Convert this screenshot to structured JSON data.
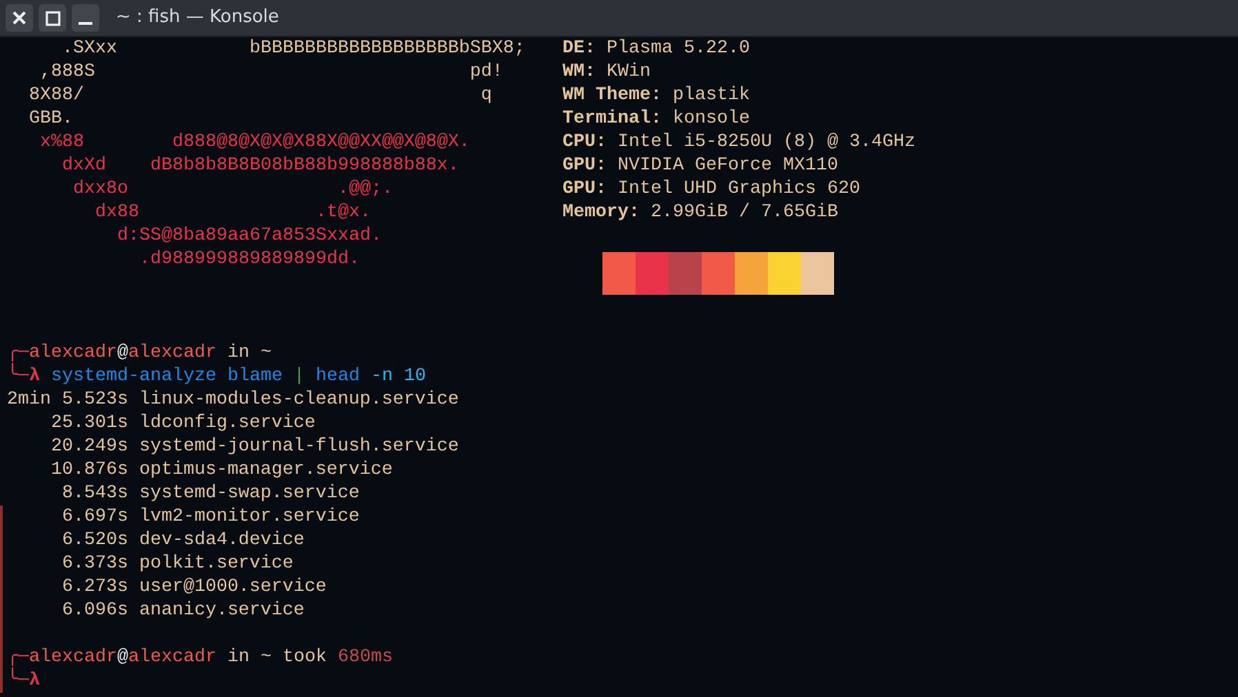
{
  "window": {
    "title": "~ : fish — Konsole"
  },
  "art": [
    {
      "text": "     .SXxx            bBBBBBBBBBBBBBBBBBBbSBX8;",
      "color": "#e6c49a"
    },
    {
      "text": "   ,888S                                  pd!",
      "color": "#e6c49a"
    },
    {
      "text": "  8X88/                                    q",
      "color": "#e6c49a"
    },
    {
      "text": "  GBB.",
      "color": "#e6c49a"
    },
    {
      "text": "   x%88        d888@8@X@X@X88X@@XX@@X@8@X.",
      "color": "#e8334a"
    },
    {
      "text": "     dxXd    dB8b8b8B8B08bB88b998888b88x.",
      "color": "#e8334a"
    },
    {
      "text": "      dxx8o                   .@@;.",
      "color": "#e8334a"
    },
    {
      "text": "        dx88                .t@x.",
      "color": "#e8334a"
    },
    {
      "text": "          d:SS@8ba89aa67a853Sxxad.",
      "color": "#e8334a"
    },
    {
      "text": "            .d988999889889899dd.",
      "color": "#e8334a"
    }
  ],
  "info": [
    {
      "key": "DE",
      "sep": ":",
      "value": "Plasma 5.22.0"
    },
    {
      "key": "WM",
      "sep": ":",
      "value": "KWin"
    },
    {
      "key": "WM Theme",
      "sep": ":",
      "value": "plastik"
    },
    {
      "key": "Terminal",
      "sep": ":",
      "value": "konsole"
    },
    {
      "key": "CPU",
      "sep": ":",
      "value": "Intel i5-8250U (8) @ 3.4GHz"
    },
    {
      "key": "GPU",
      "sep": ":",
      "value": "NVIDIA GeForce MX110"
    },
    {
      "key": "GPU",
      "sep": ":",
      "value": "Intel UHD Graphics 620"
    },
    {
      "key": "Memory",
      "sep": ":",
      "value": "2.99GiB / 7.65GiB"
    }
  ],
  "swatches": [
    {
      "color": "#f25a48"
    },
    {
      "color": "#e8334a"
    },
    {
      "color": "#b8434b"
    },
    {
      "color": "#f25a48"
    },
    {
      "color": "#f5a33b"
    },
    {
      "color": "#fad232"
    },
    {
      "color": "#ecc49d"
    }
  ],
  "session": [
    {
      "kind": "prompt",
      "marked": false,
      "segments": [
        {
          "kind": "decor",
          "text": "╭─"
        },
        {
          "kind": "user",
          "text": "alexcadr"
        },
        {
          "kind": "at",
          "text": "@"
        },
        {
          "kind": "user",
          "text": "alexcadr"
        },
        {
          "kind": "plain",
          "text": "in"
        },
        {
          "kind": "plain",
          "text": "~"
        }
      ]
    },
    {
      "kind": "prompt",
      "marked": false,
      "segments": [
        {
          "kind": "decor",
          "text": "╰─"
        },
        {
          "kind": "decor",
          "text": "λ"
        },
        {
          "kind": "command",
          "text": "systemd-analyze"
        },
        {
          "kind": "command",
          "text": "blame"
        },
        {
          "kind": "pipe",
          "text": "|"
        },
        {
          "kind": "command",
          "text": "head"
        },
        {
          "kind": "arg",
          "text": "-n"
        },
        {
          "kind": "arg",
          "text": "10"
        }
      ]
    },
    {
      "kind": "output",
      "marked": false,
      "time": "2min 5.523s",
      "unit": "linux-modules-cleanup.service"
    },
    {
      "kind": "output",
      "marked": false,
      "time": "25.301s",
      "unit": "ldconfig.service"
    },
    {
      "kind": "output",
      "marked": false,
      "time": "20.249s",
      "unit": "systemd-journal-flush.service"
    },
    {
      "kind": "output",
      "marked": false,
      "time": "10.876s",
      "unit": "optimus-manager.service"
    },
    {
      "kind": "output",
      "marked": false,
      "time": "8.543s",
      "unit": "systemd-swap.service"
    },
    {
      "kind": "output",
      "marked": true,
      "time": "6.697s",
      "unit": "lvm2-monitor.service"
    },
    {
      "kind": "output",
      "marked": true,
      "time": "6.520s",
      "unit": "dev-sda4.device"
    },
    {
      "kind": "output",
      "marked": true,
      "time": "6.373s",
      "unit": "polkit.service"
    },
    {
      "kind": "output",
      "marked": true,
      "time": "6.273s",
      "unit": "user@1000.service"
    },
    {
      "kind": "output",
      "marked": true,
      "time": "6.096s",
      "unit": "ananicy.service"
    },
    {
      "kind": "blank",
      "marked": true
    },
    {
      "kind": "prompt",
      "marked": true,
      "segments": [
        {
          "kind": "decor",
          "text": "╭─"
        },
        {
          "kind": "user",
          "text": "alexcadr"
        },
        {
          "kind": "at",
          "text": "@"
        },
        {
          "kind": "user",
          "text": "alexcadr"
        },
        {
          "kind": "plain",
          "text": "in"
        },
        {
          "kind": "plain",
          "text": "~"
        },
        {
          "kind": "plain",
          "text": "took"
        },
        {
          "kind": "duration",
          "text": "680ms"
        }
      ]
    },
    {
      "kind": "prompt",
      "marked": true,
      "segments": [
        {
          "kind": "decor",
          "text": "╰─"
        },
        {
          "kind": "decor",
          "text": "λ"
        }
      ]
    }
  ]
}
